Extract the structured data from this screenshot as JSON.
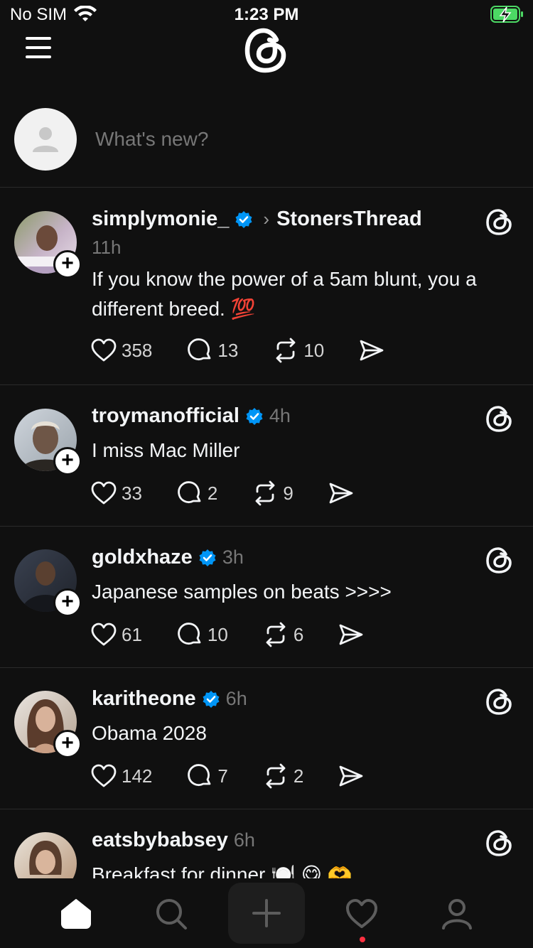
{
  "status_bar": {
    "carrier": "No SIM",
    "time": "1:23 PM",
    "battery_color": "#4cd964"
  },
  "composer": {
    "placeholder": "What's new?"
  },
  "accent_colors": {
    "verified": "#0095f6",
    "notification_dot": "#ff3040"
  },
  "posts": [
    {
      "username": "simplymonie_",
      "verified": true,
      "community": "StonersThread",
      "time": "11h",
      "text": "If you know the power of a 5am blunt, you a different breed. 💯",
      "likes": "358",
      "replies": "13",
      "reposts": "10",
      "avatar_colors": [
        "#8c9b6a",
        "#c7b4c8"
      ]
    },
    {
      "username": "troymanofficial",
      "verified": true,
      "time": "4h",
      "text": "I miss Mac Miller",
      "likes": "33",
      "replies": "2",
      "reposts": "9",
      "avatar_colors": [
        "#7a6a5c",
        "#cfd5dc"
      ]
    },
    {
      "username": "goldxhaze",
      "verified": true,
      "time": "3h",
      "text": "Japanese samples on beats >>>>",
      "likes": "61",
      "replies": "10",
      "reposts": "6",
      "avatar_colors": [
        "#2a2f3a",
        "#5a4a3c"
      ]
    },
    {
      "username": "karitheone",
      "verified": true,
      "time": "6h",
      "text": "Obama 2028",
      "likes": "142",
      "replies": "7",
      "reposts": "2",
      "avatar_colors": [
        "#c9a58f",
        "#6b4a3a"
      ]
    },
    {
      "username": "eatsbybabsey",
      "verified": false,
      "time": "6h",
      "text": "Breakfast for dinner 🍽️ 😋 🫶",
      "avatar_colors": [
        "#b99679",
        "#e8e2d8"
      ]
    }
  ],
  "tab_bar": {
    "items": [
      "home-icon",
      "search-icon",
      "plus-icon",
      "heart-icon",
      "profile-icon"
    ],
    "active": "home-icon"
  }
}
